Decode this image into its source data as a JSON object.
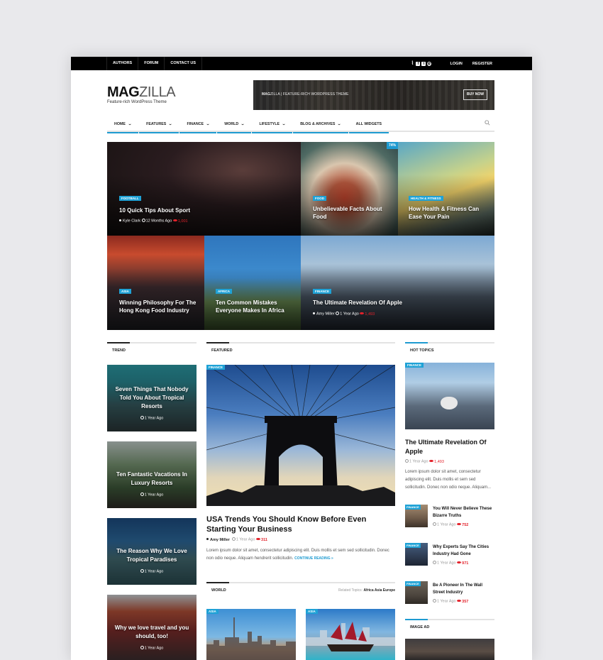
{
  "topbar": {
    "links": [
      "AUTHORS",
      "FORUM",
      "CONTACT US"
    ],
    "social_icons": [
      "rss-icon",
      "facebook-icon",
      "twitter-icon",
      "pinterest-icon"
    ],
    "login": "LOGIN",
    "register": "REGISTER"
  },
  "header": {
    "logo_bold": "MAG",
    "logo_light": "ZILLA",
    "tagline": "Feature-rich WordPress Theme",
    "banner": {
      "brand_bold": "MAG",
      "brand_rest": "ZILLA | FEATURE-RICH WORDPRESS THEME",
      "button": "BUY NOW"
    }
  },
  "nav": {
    "items": [
      {
        "label": "HOME",
        "dropdown": true
      },
      {
        "label": "FEATURES",
        "dropdown": true
      },
      {
        "label": "FINANCE",
        "dropdown": true
      },
      {
        "label": "WORLD",
        "dropdown": true
      },
      {
        "label": "LIFESTYLE",
        "dropdown": true
      },
      {
        "label": "BLOG & ARCHIVES",
        "dropdown": true
      },
      {
        "label": "ALL WIDGETS",
        "dropdown": false
      }
    ],
    "chevron": "⌄"
  },
  "hero": [
    {
      "category": "FOOTBALL",
      "title": "10 Quick Tips About Sport",
      "author": "Kyle Clark",
      "time": "12 Months Ago",
      "views": "1,001"
    },
    {
      "category": "FOOD",
      "title": "Unbelievable Facts About Food",
      "badge": "74%"
    },
    {
      "category": "HEALTH & FITNESS",
      "title": "How Health & Fitness Can Ease Your Pain"
    },
    {
      "category": "ASIA",
      "title": "Winning Philosophy For The Hong Kong Food Industry"
    },
    {
      "category": "AFRICA",
      "title": "Ten Common Mistakes Everyone Makes In Africa"
    },
    {
      "category": "FINANCE",
      "title": "The Ultimate Revelation Of Apple",
      "author": "Amy Miller",
      "time": "1 Year Ago",
      "views": "1,493"
    }
  ],
  "sections": {
    "trend": "TREND",
    "featured": "FEATURED",
    "hot_topics": "HOT TOPICS",
    "world": "WORLD",
    "image_ad": "IMAGE AD",
    "related_label": "Related Topics:",
    "related_topics": "Africa Asia Europe"
  },
  "trend": [
    {
      "title": "Seven Things That Nobody Told You About Tropical Resorts",
      "time": "1 Year Ago"
    },
    {
      "title": "Ten Fantastic Vacations In Luxury Resorts",
      "time": "1 Year Ago"
    },
    {
      "title": "The Reason Why We Love Tropical Paradises",
      "time": "1 Year Ago"
    },
    {
      "title": "Why we love travel and you should, too!",
      "time": "1 Year Ago"
    }
  ],
  "featured": {
    "category": "FINANCE",
    "title": "USA Trends You Should Know Before Even Starting Your Business",
    "author": "Amy Miller",
    "time": "1 Year Ago",
    "views": "311",
    "excerpt": "Lorem ipsum dolor sit amet, consectetur adipiscing elit. Duis mollis et sem sed sollicitudin. Donec non odio neque. Aliquam hendrerit sollicitudin.",
    "continue": "CONTINUE READING »"
  },
  "world": [
    {
      "category": "ASIA"
    },
    {
      "category": "ASIA"
    }
  ],
  "hot": {
    "category": "FINANCE",
    "title": "The Ultimate Revelation Of Apple",
    "time": "1 Year Ago",
    "views": "1,493",
    "excerpt": "Lorem ipsum dolor sit amet, consectetur adipiscing elit. Duis mollis et sem sed sollicitudin. Donec non odio neque. Aliquam...",
    "list": [
      {
        "category": "FINANCE",
        "title": "You Will Never Believe These Bizarre Truths",
        "time": "1 Year Ago",
        "views": "752"
      },
      {
        "category": "FINANCE",
        "title": "Why Experts Say The Cities Industry Had Gone",
        "time": "1 Year Ago",
        "views": "971"
      },
      {
        "category": "FINANCE",
        "title": "Be A Pioneer In The Wall Street Industry",
        "time": "1 Year Ago",
        "views": "357"
      }
    ]
  },
  "colors": {
    "accent": "#1e9bd1",
    "views": "#e3222b",
    "topbar": "#000000"
  }
}
